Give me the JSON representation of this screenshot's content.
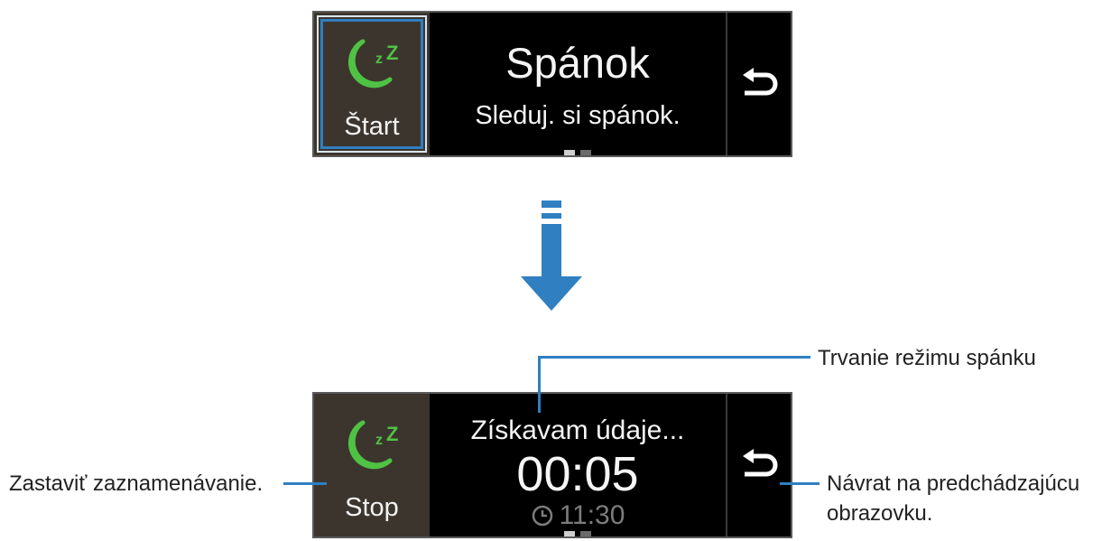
{
  "top_screen": {
    "button_label": "Štart",
    "title": "Spánok",
    "subtitle": "Sleduj. si spánok."
  },
  "bottom_screen": {
    "button_label": "Stop",
    "status": "Získavam údaje...",
    "timer": "00:05",
    "alarm_time": "11:30"
  },
  "callouts": {
    "duration": "Trvanie režimu spánku",
    "stop": "Zastaviť zaznamenávanie.",
    "back_line1": "Návrat na predchádzajúcu",
    "back_line2": "obrazovku."
  },
  "icons": {
    "sleep": "moon-zz-icon",
    "back": "back-arrow-icon",
    "alarm": "clock-icon",
    "flow": "down-arrow-icon"
  },
  "colors": {
    "accent_green": "#4fc244",
    "callout_blue": "#2f7fc1",
    "panel_brown": "#3c352e"
  }
}
